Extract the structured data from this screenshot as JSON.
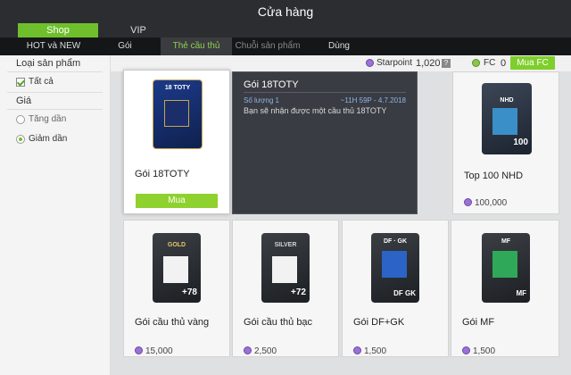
{
  "window": {
    "title": "Cửa hàng"
  },
  "tabs_primary": [
    {
      "label": "Shop",
      "active": true
    },
    {
      "label": "VIP",
      "active": false
    }
  ],
  "tabs_secondary": [
    {
      "label": "HOT và NEW"
    },
    {
      "label": "Gói"
    },
    {
      "label": "Thẻ cầu thủ",
      "active": true
    },
    {
      "label": "Chuỗi sản phẩm"
    },
    {
      "label": "Dùng"
    }
  ],
  "sidebar": {
    "category_heading": "Loại sản phẩm",
    "category_all": "Tất cả",
    "price_heading": "Giá",
    "sort_ascending": "Tăng dần",
    "sort_descending": "Giảm dần"
  },
  "topbar": {
    "starpoint_label": "Starpoint",
    "starpoint_value": "1,020",
    "help": "?",
    "fc_label": "FC",
    "fc_value": "0",
    "buy_fc": "Mua FC"
  },
  "tooltip": {
    "title": "Gói 18TOTY",
    "quantity": "Số lượng 1",
    "expiry": "~11H 59P - 4.7.2018",
    "description": "Bạn sẽ nhận được một cầu thủ 18TOTY"
  },
  "products": [
    {
      "name": "Gói 18TOTY",
      "card_label": "18 TOTY",
      "buy_label": "Mua"
    },
    {
      "name": "Top 100 NHD",
      "card_label": "NHD",
      "card_rating": "100",
      "price": "100,000"
    },
    {
      "name": "Gói cầu thủ vàng",
      "card_label": "GOLD",
      "card_rating": "+78",
      "price": "15,000"
    },
    {
      "name": "Gói cầu thủ bạc",
      "card_label": "SILVER",
      "card_rating": "+72",
      "price": "2,500"
    },
    {
      "name": "Gói DF+GK",
      "card_label": "DF · GK",
      "card_rating": "DF GK",
      "price": "1,500"
    },
    {
      "name": "Gói MF",
      "card_label": "MF",
      "card_rating": "MF",
      "price": "1,500"
    }
  ],
  "colors": {
    "accent": "#6fbf2d",
    "starpoint": "#9a72d6",
    "fc": "#8bc54a"
  }
}
